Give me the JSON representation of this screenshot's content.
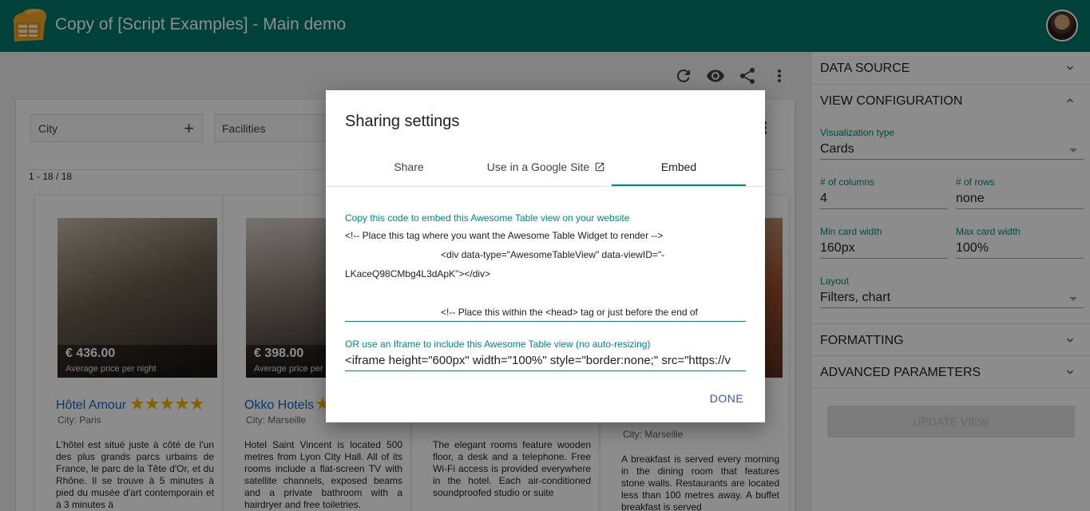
{
  "app": {
    "title": "Copy of [Script Examples] - Main demo"
  },
  "toolbar": {
    "icons": [
      "refresh-icon",
      "eye-icon",
      "share-icon",
      "more-vert-icon"
    ]
  },
  "filters": [
    {
      "label": "City"
    },
    {
      "label": "Facilities"
    }
  ],
  "table": {
    "row_count": "1 - 18 / 18"
  },
  "cards": [
    {
      "name": "Hôtel Amour",
      "stars": "★★★★★",
      "city": "City: Paris",
      "price": "€ 436.00",
      "price_label": "Average price per night",
      "description": "L'hôtel est situé juste à côté de l'un des plus grands parcs urbains de France, le parc de la Tête d'Or, et du Rhône. Il se trouve à 5 minutes à pied du musée d'art contemporain et à 3 minutes à"
    },
    {
      "name": "Okko Hotels",
      "stars": "★",
      "city": "City: Marseille",
      "price": "€ 398.00",
      "price_label": "Average price per night",
      "description": "Hotel Saint Vincent is located 500 metres from Lyon City Hall. All of its rooms include a flat-screen TV with satellite channels, exposed beams and a private bathroom with a hairdryer and free toiletries."
    },
    {
      "name": "",
      "stars": "",
      "city": "",
      "price": "",
      "price_label": "",
      "description": "The elegant rooms feature wooden floor, a desk and a telephone. Free Wi-Fi access is provided everywhere in the hotel. Each air-conditioned soundproofed studio or suite"
    },
    {
      "name": "",
      "stars": "",
      "city": "City: Marseille",
      "price": "",
      "price_label": "",
      "description": "A breakfast is served every morning in the dining room that features stone walls. Restaurants are located less than 100 metres away. A buffet breakfast is served"
    }
  ],
  "config": {
    "sections": {
      "data_source": "DATA SOURCE",
      "view_configuration": "VIEW CONFIGURATION",
      "formatting": "FORMATTING",
      "advanced_parameters": "ADVANCED PARAMETERS"
    },
    "visualization_type": {
      "label": "Visualization type",
      "value": "Cards"
    },
    "columns": {
      "label": "# of columns",
      "value": "4"
    },
    "rows": {
      "label": "# of rows",
      "value": "none"
    },
    "min_card_width": {
      "label": "Min card width",
      "value": "160px"
    },
    "max_card_width": {
      "label": "Max card width",
      "value": "100%"
    },
    "layout": {
      "label": "Layout",
      "value": "Filters, chart"
    },
    "update_button": "UPDATE VIEW"
  },
  "dialog": {
    "title": "Sharing settings",
    "tabs": [
      {
        "label": "Share"
      },
      {
        "label": "Use in a Google Site"
      },
      {
        "label": "Embed"
      }
    ],
    "active_tab": "Embed",
    "code_label": "Copy this code to embed this Awesome Table view on your website",
    "code_text": "<!-- Place this tag where you want the Awesome Table Widget to render -->\n                                    <div data-type=\"AwesomeTableView\" data-viewID=\"-\nLKaceQ98CMbg4L3dApK\"></div>\n\n                                    <!-- Place this within the <head> tag or just before the end of",
    "iframe_label": "OR use an Iframe to include this Awesome Table view (no auto-resizing)",
    "iframe_value": "<iframe height=\"600px\" width=\"100%\" style=\"border:none;\" src=\"https://v",
    "done_label": "DONE"
  },
  "colors": {
    "appbar": "#00796b",
    "accent": "#00897b",
    "button_text": "#3f51b5",
    "star": "#f4b400",
    "link": "#1565c0"
  }
}
